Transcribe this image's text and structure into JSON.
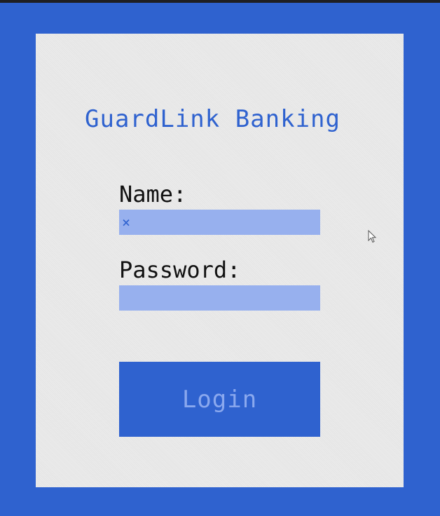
{
  "app": {
    "title": "GuardLink Banking"
  },
  "form": {
    "name_label": "Name:",
    "name_value": "×",
    "password_label": "Password:",
    "password_value": "",
    "login_label": "Login"
  },
  "colors": {
    "background": "#2f62cf",
    "panel": "#ececec",
    "field": "#97b0ee",
    "accent": "#2f62cf",
    "button_text": "#8aa8ee"
  },
  "icons": {
    "cursor": "mouse-pointer-icon"
  }
}
